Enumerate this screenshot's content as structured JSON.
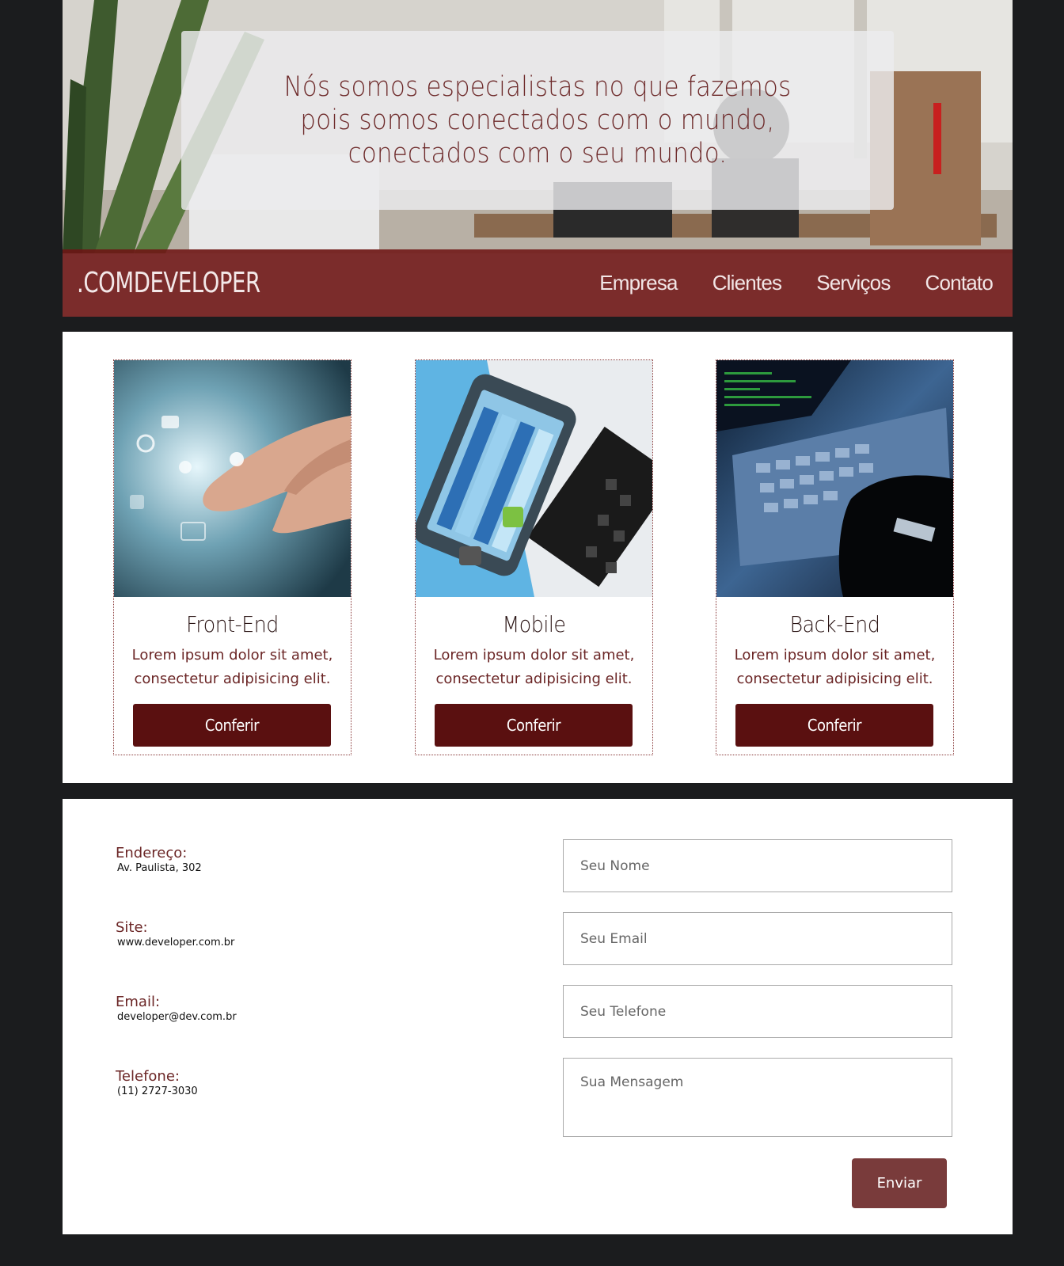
{
  "hero": {
    "quote": "Nós somos especialistas no que fazemos pois somos conectados com o mundo, conectados com o seu mundo."
  },
  "navbar": {
    "logo": ".COMDEVELOPER",
    "links": [
      "Empresa",
      "Clientes",
      "Serviços",
      "Contato"
    ]
  },
  "services": {
    "cards": [
      {
        "title": "Front-End",
        "text": "Lorem ipsum dolor sit amet, consectetur adipisicing elit.",
        "button": "Conferir"
      },
      {
        "title": "Mobile",
        "text": "Lorem ipsum dolor sit amet, consectetur adipisicing elit.",
        "button": "Conferir"
      },
      {
        "title": "Back-End",
        "text": "Lorem ipsum dolor sit amet, consectetur adipisicing elit.",
        "button": "Conferir"
      }
    ]
  },
  "contact": {
    "info": [
      {
        "label": "Endereço:",
        "value": "Av. Paulista, 302"
      },
      {
        "label": "Site:",
        "value": "www.developer.com.br"
      },
      {
        "label": "Email:",
        "value": "developer@dev.com.br"
      },
      {
        "label": "Telefone:",
        "value": "(11) 2727-3030"
      }
    ],
    "form": {
      "name_placeholder": "Seu Nome",
      "email_placeholder": "Seu Email",
      "phone_placeholder": "Seu Telefone",
      "message_placeholder": "Sua Mensagem",
      "submit_label": "Enviar"
    }
  },
  "colors": {
    "brand": "#5a1010",
    "navbar": "#6e1414",
    "accent_text": "#6b2626",
    "page_bg": "#1b1c1e"
  }
}
